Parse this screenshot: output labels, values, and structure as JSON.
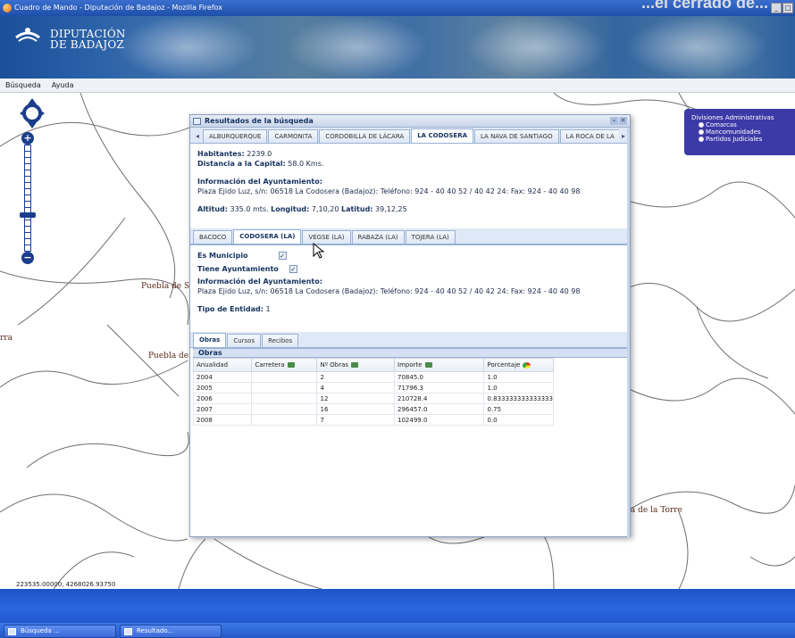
{
  "window": {
    "title": "Cuadro de Mando - Diputación de Badajoz - Mozilla Firefox",
    "overlay_text": "...el cerrado de..."
  },
  "banner": {
    "logo_line1": "DIPUTACIÓN",
    "logo_line2": "DE BADAJOZ"
  },
  "menu": [
    "Búsqueda",
    "Ayuda"
  ],
  "map": {
    "places": [
      "Puebla de Sa",
      "Puebla de S",
      "rra",
      "cía de la Torre"
    ],
    "coords": "223535.00000, 4268026.93750"
  },
  "layers": {
    "title": "Divisiones Administrativas",
    "options": [
      "Comarcas",
      "Mancomunidades",
      "Partidos Judiciales"
    ]
  },
  "results": {
    "title": "Resultados de la búsqueda",
    "town_tabs": [
      "ALBURQUERQUE",
      "CARMONITA",
      "CORDOBILLA DE LÁCARA",
      "LA CODOSERA",
      "LA NAVA DE SANTIAGO",
      "LA ROCA DE LA"
    ],
    "town_info": {
      "habitantes_label": "Habitantes:",
      "habitantes": "2239.0",
      "distancia_label": "Distancia a la Capital:",
      "distancia": "58.0 Kms.",
      "info_label": "Información del Ayuntamiento:",
      "info": "Plaza Ejido Luz, s/n: 06518 La Codosera (Badajoz): Teléfono: 924 - 40 40 52 / 40 42 24: Fax: 924 - 40 40 98",
      "altitud_label": "Altitud:",
      "altitud": "335.0 mts.",
      "longitud_label": "Longitud:",
      "longitud": "7,10,20",
      "latitud_label": "Latitud:",
      "latitud": "39,12,25"
    },
    "entity_tabs": [
      "BACOCO",
      "CODOSERA (LA)",
      "VEGSE (LA)",
      "RABAZA (LA)",
      "TOJERA (LA)"
    ],
    "entity_info": {
      "es_municipio_label": "Es Municipio",
      "tiene_ayto_label": "Tiene Ayuntamiento",
      "info_label": "Información del Ayuntamiento:",
      "info": "Plaza Ejido Luz, s/n: 06518 La Codosera (Badajoz): Teléfono: 924 - 40 40 52 / 40 42 24: Fax: 924 - 40 40 98",
      "tipo_label": "Tipo de Entidad:",
      "tipo": "1"
    },
    "data_tabs": [
      "Obras",
      "Cursos",
      "Recibos"
    ],
    "obras": {
      "title": "Obras",
      "columns": [
        "Anualidad",
        "Carretera",
        "Nº Obras",
        "Importe",
        "Porcentaje"
      ],
      "rows": [
        [
          "2004",
          "",
          "2",
          "70845.0",
          "1.0"
        ],
        [
          "2005",
          "",
          "4",
          "71796.3",
          "1.0"
        ],
        [
          "2006",
          "",
          "12",
          "210728.4",
          "0.833333333333333"
        ],
        [
          "2007",
          "",
          "16",
          "296457.0",
          "0.75"
        ],
        [
          "2008",
          "",
          "7",
          "102499.0",
          "0.0"
        ]
      ]
    }
  },
  "taskbar": [
    "Búsqueda ...",
    "Resultado..."
  ]
}
